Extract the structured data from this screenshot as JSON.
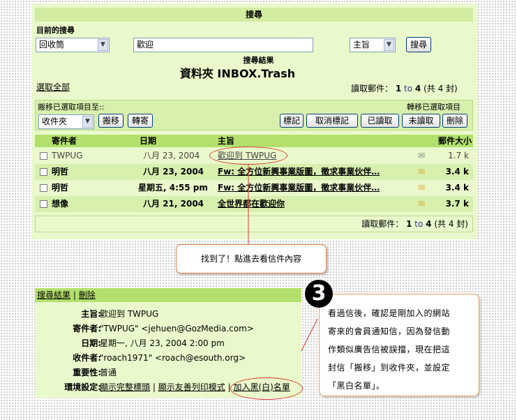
{
  "search": {
    "title": "搜尋",
    "current_label": "目前的搜尋",
    "folder_select": "回收筒",
    "query_value": "歡迎",
    "field_select": "主旨",
    "search_button": "搜尋",
    "results_label": "搜尋結果",
    "folder_title": "資料夾 INBOX.Trash"
  },
  "list": {
    "select_all": "選取全部",
    "read_label": "讀取郵件：",
    "range_from": "1",
    "range_to_word": "to",
    "range_to": "4",
    "total": "(共 4 封)",
    "move_label": "搬移已選取項目至::",
    "forward_label": "轉移已選取項目",
    "move_select": "收件夾",
    "move_button": "搬移",
    "forward_button": "轉寄",
    "mark_button": "標記",
    "unmark_button": "取消標記",
    "read_button": "已讀取",
    "unread_button": "未讀取",
    "delete_button": "刪除"
  },
  "table": {
    "columns": [
      "寄件者",
      "日期",
      "主旨",
      "郵件大小"
    ],
    "rows": [
      {
        "from": "TWPUG",
        "date": "八月 23, 2004",
        "subject": "歡迎到 TWPUG",
        "size": "1.7 k"
      },
      {
        "from": "明哲",
        "date": "八月 23, 2004",
        "subject": "Fw: 全方位新興事業版圖，徵求事業伙伴…",
        "size": "3.4 k"
      },
      {
        "from": "明哲",
        "date": "星期五, 4:55 pm",
        "subject": "Fw: 全方位新興事業版圖，徵求事業伙伴…",
        "size": "3.4 k"
      },
      {
        "from": "想像",
        "date": "八月 21, 2004",
        "subject": "全世界都在歡迎你",
        "size": "3.7 k"
      }
    ]
  },
  "callout1": "找到了！點進去看信件內容",
  "message": {
    "results_link": "搜尋結果",
    "separator": "|",
    "delete_link": "刪除",
    "subject_k": "主旨:",
    "subject_v": "歡迎到 TWPUG",
    "from_k": "寄件者:",
    "from_v": "\"TWPUG\" <jehuen@GozMedia.com>",
    "date_k": "日期:",
    "date_v": "星期一, 八月 23, 2004 2:00 pm",
    "to_k": "收件者:",
    "to_v": "\"roach1971\" <roach@esouth.org>",
    "priority_k": "重要性:",
    "priority_v": "普通",
    "options_k": "環境設定:",
    "opt_headers": "顯示完整標頭",
    "opt_print": "顯示友善列印模式",
    "opt_blacklist": "加入黑(白)名單"
  },
  "badge": "3",
  "note_lines": [
    "看過信後，確認是剛加入的網站",
    "寄來的會員通知信，因為發信動",
    "作類似廣告信被誤擋，現在把這",
    "封信「搬移」到收件夾，並設定",
    "「黑白名單」。"
  ]
}
